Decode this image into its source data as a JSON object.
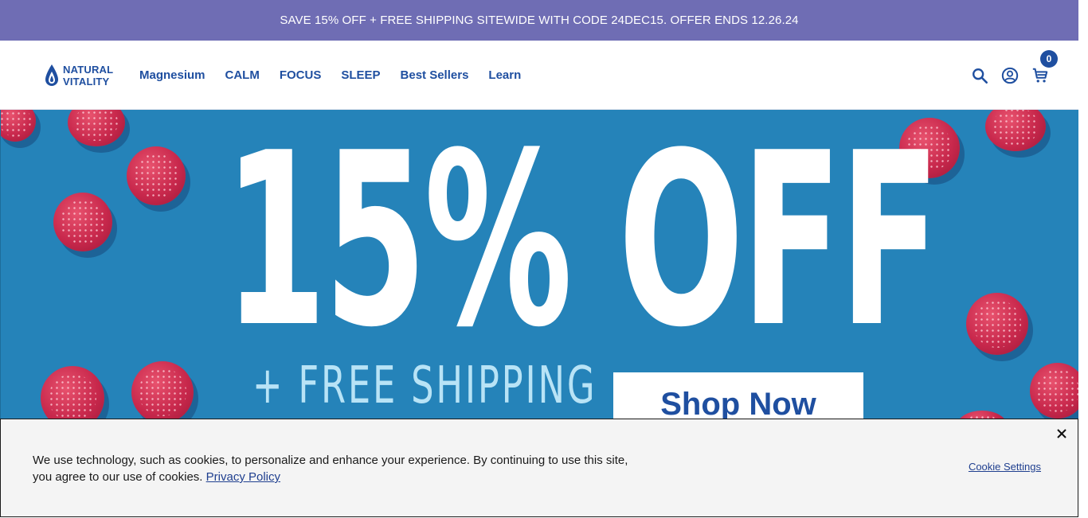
{
  "promo": {
    "text": "SAVE 15% OFF + FREE SHIPPING SITEWIDE WITH CODE 24DEC15. OFFER ENDS 12.26.24"
  },
  "brand": {
    "line1": "NATURAL",
    "line2": "VITALITY"
  },
  "nav": {
    "items": [
      "Magnesium",
      "CALM",
      "FOCUS",
      "SLEEP",
      "Best Sellers",
      "Learn"
    ]
  },
  "header": {
    "cart_count": "0"
  },
  "hero": {
    "headline": "15% OFF",
    "subline": "+ FREE SHIPPING",
    "cta": "Shop Now"
  },
  "cookie": {
    "message": "We use technology, such as cookies, to personalize and enhance your experience. By continuing to use this site, you agree to our use of cookies.",
    "privacy_link": "Privacy Policy",
    "settings_link": "Cookie Settings"
  },
  "colors": {
    "promo_bg": "#6f6db4",
    "brand_blue": "#1f4fa0",
    "hero_bg": "#2583b9",
    "gummy": "#c8284c"
  },
  "icons": [
    "drop-logo-icon",
    "search-icon",
    "account-icon",
    "cart-icon",
    "close-icon"
  ]
}
